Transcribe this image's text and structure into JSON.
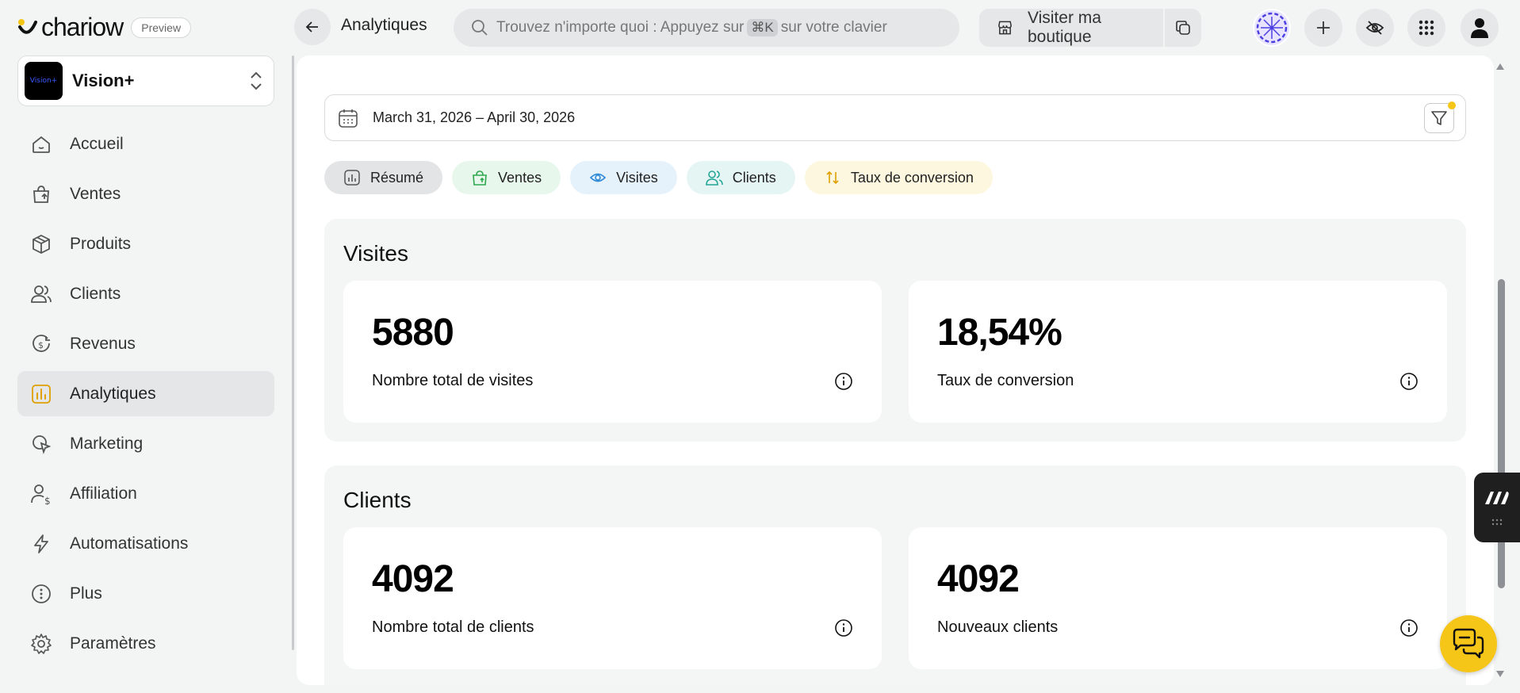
{
  "brand": {
    "name": "chariow",
    "badge": "Preview"
  },
  "store": {
    "name": "Vision+",
    "logo_text": "Vision+"
  },
  "sidebar": {
    "items": [
      {
        "label": "Accueil",
        "icon": "home-icon",
        "active": false
      },
      {
        "label": "Ventes",
        "icon": "shopping-bag-icon",
        "active": false
      },
      {
        "label": "Produits",
        "icon": "box-icon",
        "active": false
      },
      {
        "label": "Clients",
        "icon": "users-icon",
        "active": false
      },
      {
        "label": "Revenus",
        "icon": "revenue-icon",
        "active": false
      },
      {
        "label": "Analytiques",
        "icon": "bar-chart-icon",
        "active": true
      },
      {
        "label": "Marketing",
        "icon": "megaphone-icon",
        "active": false
      },
      {
        "label": "Affiliation",
        "icon": "affiliate-icon",
        "active": false
      },
      {
        "label": "Automatisations",
        "icon": "lightning-icon",
        "active": false
      },
      {
        "label": "Plus",
        "icon": "more-icon",
        "active": false
      },
      {
        "label": "Paramètres",
        "icon": "gear-icon",
        "active": false
      }
    ]
  },
  "header": {
    "title": "Analytiques",
    "search_placeholder_before": "Trouvez n'importe quoi : Appuyez sur",
    "search_kbd": "⌘K",
    "search_placeholder_after": "sur votre clavier",
    "visit_label": "Visiter ma boutique"
  },
  "filters": {
    "date_range": "March 31, 2026 – April 30, 2026"
  },
  "tabs": [
    {
      "label": "Résumé",
      "icon": "summary-icon"
    },
    {
      "label": "Ventes",
      "icon": "shopping-bag-icon"
    },
    {
      "label": "Visites",
      "icon": "eye-icon"
    },
    {
      "label": "Clients",
      "icon": "users-icon"
    },
    {
      "label": "Taux de conversion",
      "icon": "conversion-icon"
    }
  ],
  "sections": {
    "visites": {
      "title": "Visites",
      "cards": [
        {
          "value": "5880",
          "label": "Nombre total de visites"
        },
        {
          "value": "18,54%",
          "label": "Taux de conversion"
        }
      ]
    },
    "clients": {
      "title": "Clients",
      "cards": [
        {
          "value": "4092",
          "label": "Nombre total de clients"
        },
        {
          "value": "4092",
          "label": "Nouveaux clients"
        }
      ]
    }
  },
  "colors": {
    "accent": "#f5c518",
    "active_nav_icon": "#e0a000",
    "ventes_tab": "#2fa84f",
    "visites_tab": "#2e8ad8",
    "clients_tab": "#25a596",
    "taux_tab": "#e0a000"
  }
}
